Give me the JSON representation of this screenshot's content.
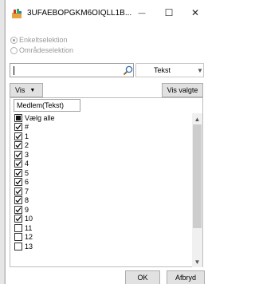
{
  "window": {
    "title": "3UFAEBOPGKM6OIQLL1B...",
    "minimize_glyph": "—",
    "maximize_glyph": "☐",
    "close_glyph": "✕"
  },
  "selection_mode": {
    "options": [
      {
        "label": "Enkeltselektion",
        "checked": true
      },
      {
        "label": "Områdeselektion",
        "checked": false
      }
    ]
  },
  "search": {
    "value": "",
    "type_value": "Tekst",
    "icons": {
      "search": "search-icon",
      "dropdown": "chevron-down-icon"
    }
  },
  "toolbar": {
    "vis_label": "Vis",
    "vis_valgte_label": "Vis valgte"
  },
  "list": {
    "column_header": "Medlem(Tekst)",
    "items": [
      {
        "label": "Vælg alle",
        "state": "indeterminate"
      },
      {
        "label": "#",
        "state": "checked"
      },
      {
        "label": "1",
        "state": "checked"
      },
      {
        "label": "2",
        "state": "checked"
      },
      {
        "label": "3",
        "state": "checked"
      },
      {
        "label": "4",
        "state": "checked"
      },
      {
        "label": "5",
        "state": "checked"
      },
      {
        "label": "6",
        "state": "checked"
      },
      {
        "label": "7",
        "state": "checked"
      },
      {
        "label": "8",
        "state": "checked"
      },
      {
        "label": "9",
        "state": "checked"
      },
      {
        "label": "10",
        "state": "checked"
      },
      {
        "label": "11",
        "state": "unchecked"
      },
      {
        "label": "12",
        "state": "unchecked"
      },
      {
        "label": "13",
        "state": "unchecked"
      }
    ]
  },
  "footer": {
    "ok_label": "OK",
    "cancel_label": "Afbryd"
  },
  "colors": {
    "accent_icon": "#e8a33c",
    "disabled_text": "#9a9a9a"
  }
}
